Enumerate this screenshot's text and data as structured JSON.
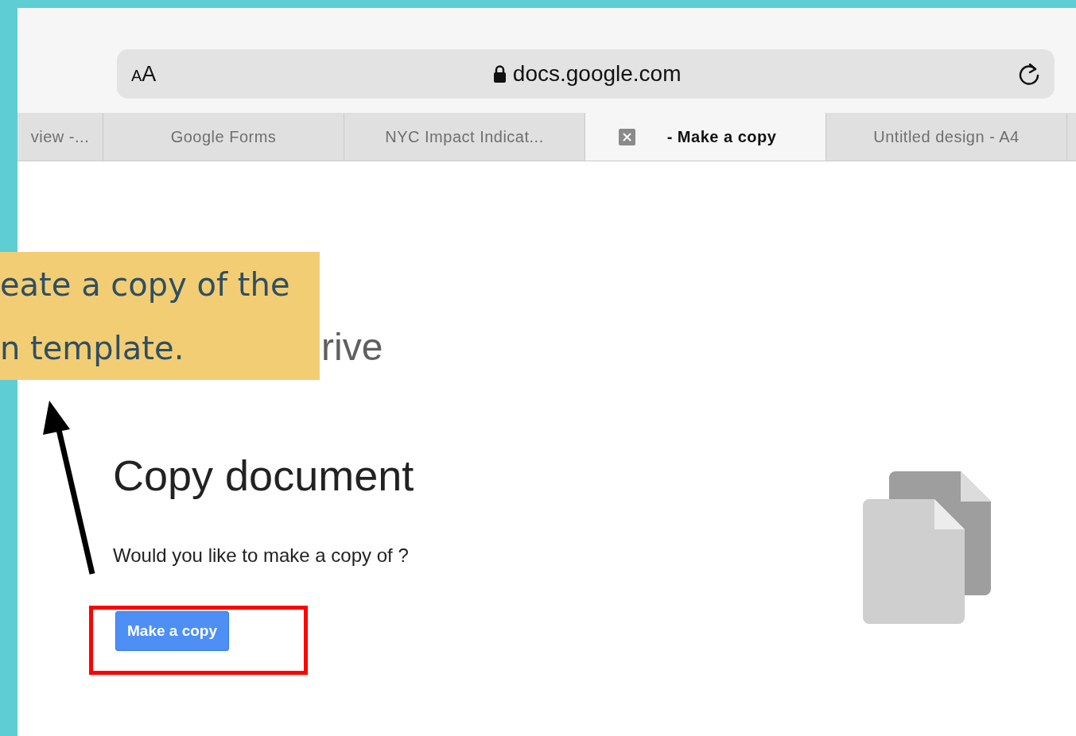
{
  "url_bar": {
    "text_size_button": "AA",
    "address": "docs.google.com"
  },
  "tabs": [
    {
      "label": "view -...",
      "selected": false
    },
    {
      "label": "Google Forms",
      "selected": false
    },
    {
      "label": "NYC Impact Indicat...",
      "selected": false
    },
    {
      "label": "- Make a copy",
      "selected": true
    },
    {
      "label": "Untitled design - A4",
      "selected": false
    }
  ],
  "page": {
    "heading_partial": "rive",
    "title": "Copy document",
    "prompt": "Would you like to make a copy of ?",
    "button": "Make a copy"
  },
  "callout": {
    "lines": [
      "eate a copy of the",
      "n template."
    ]
  }
}
